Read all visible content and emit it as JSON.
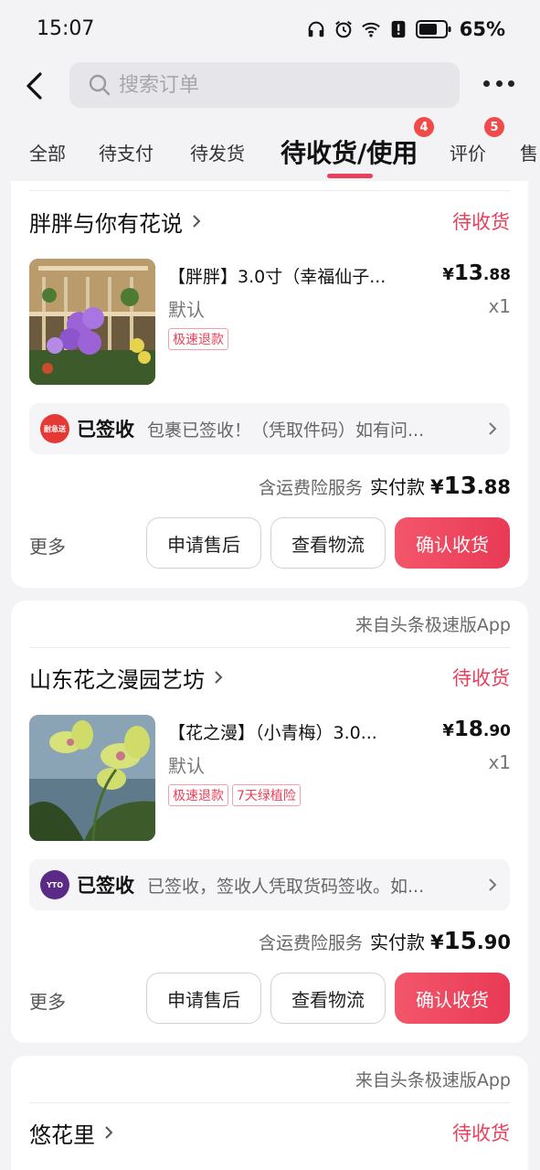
{
  "status_bar": {
    "time": "15:07",
    "battery": "65%",
    "icons": [
      "headphones-icon",
      "alarm-icon",
      "wifi-icon",
      "alert-icon",
      "battery-icon"
    ]
  },
  "header": {
    "search_placeholder": "搜索订单"
  },
  "tabs": [
    {
      "label": "全部"
    },
    {
      "label": "待支付"
    },
    {
      "label": "待发货"
    },
    {
      "label": "待收货/使用",
      "badge": "4",
      "active": true
    },
    {
      "label": "评价",
      "badge": "5"
    },
    {
      "label": "售"
    }
  ],
  "orders": [
    {
      "source": "",
      "store": "胖胖与你有花说",
      "status": "待收货",
      "item_title": "【胖胖】3.0寸（幸福仙子...",
      "price": {
        "symbol": "¥",
        "int": "13",
        "dec": ".88"
      },
      "variant": "默认",
      "qty": "x1",
      "tags": [
        "极速退款"
      ],
      "logistics": {
        "logo_text": "耐急送",
        "state": "已签收",
        "message": "包裹已签收！（凭取件码）如有问..."
      },
      "insurance": "含运费险服务",
      "paid_label": "实付款",
      "paid": {
        "symbol": "¥",
        "int": "13",
        "dec": ".88"
      },
      "more": "更多",
      "buttons": [
        "申请售后",
        "查看物流",
        "确认收货"
      ]
    },
    {
      "source": "来自头条极速版App",
      "store": "山东花之漫园艺坊",
      "status": "待收货",
      "item_title": "【花之漫】（小青梅）3.0...",
      "price": {
        "symbol": "¥",
        "int": "18",
        "dec": ".90"
      },
      "variant": "默认",
      "qty": "x1",
      "tags": [
        "极速退款",
        "7天绿植险"
      ],
      "logistics": {
        "logo_text": "YTO",
        "state": "已签收",
        "message": "已签收，签收人凭取货码签收。如..."
      },
      "insurance": "含运费险服务",
      "paid_label": "实付款",
      "paid": {
        "symbol": "¥",
        "int": "15",
        "dec": ".90"
      },
      "more": "更多",
      "buttons": [
        "申请售后",
        "查看物流",
        "确认收货"
      ]
    },
    {
      "source": "来自头条极速版App",
      "store": "悠花里",
      "status": "待收货"
    }
  ],
  "colors": {
    "accent": "#e8405a",
    "badge": "#f04a4a",
    "logo1": "#e53935",
    "logo2": "#5b2a86"
  }
}
